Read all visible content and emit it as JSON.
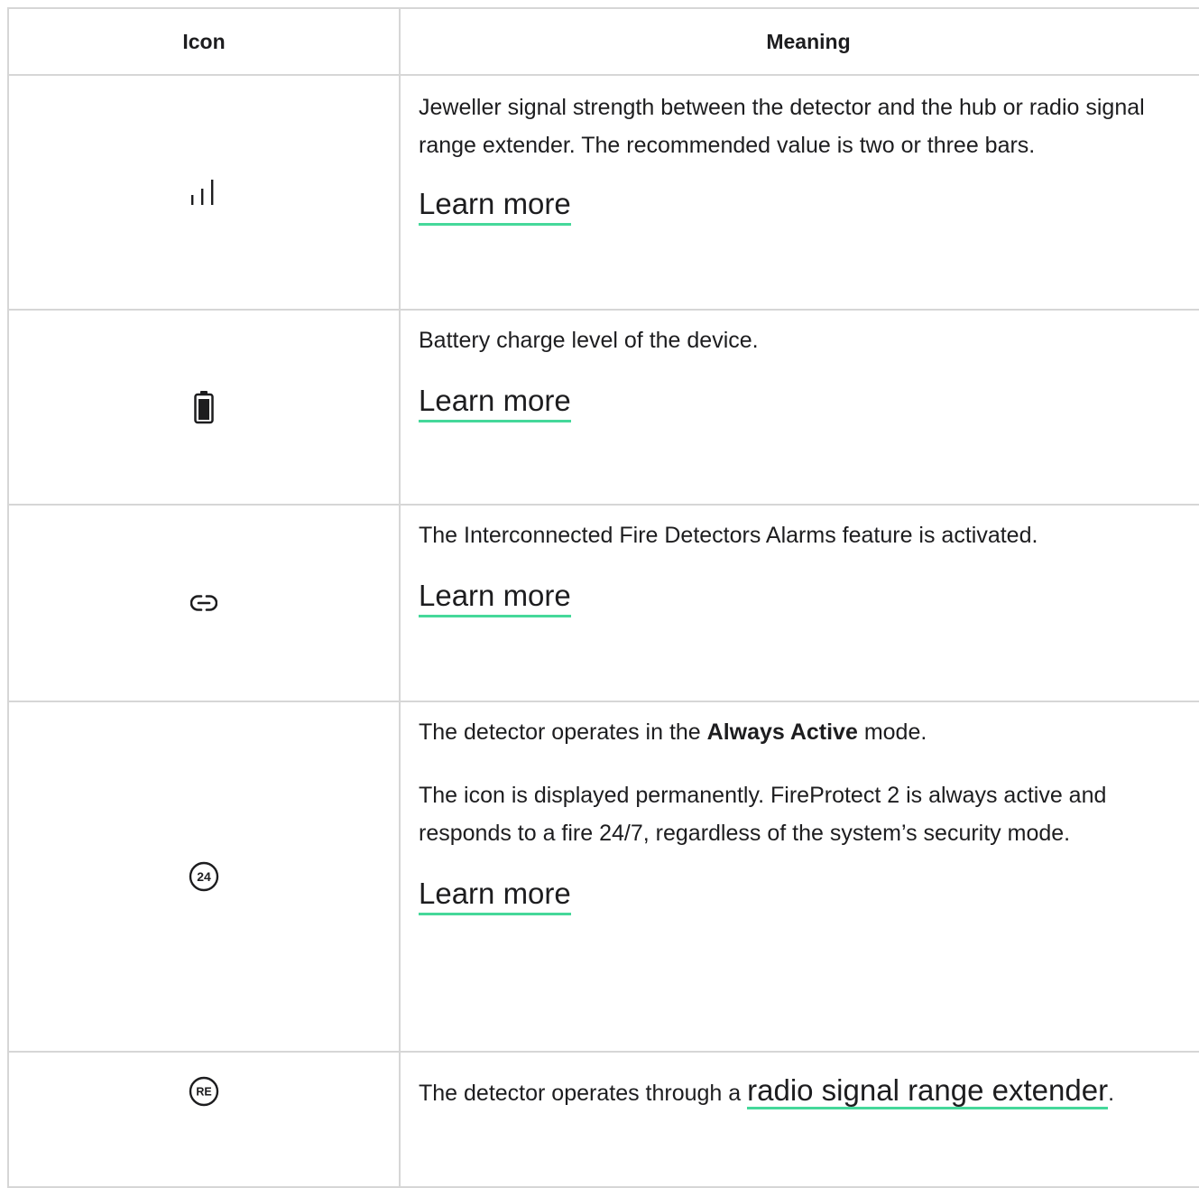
{
  "table": {
    "headers": {
      "icon": "Icon",
      "meaning": "Meaning"
    },
    "rows": [
      {
        "icon": "signal-strength-icon",
        "text": "Jeweller signal strength between the detector and the hub or radio signal range extender. The recommended value is two or three bars.",
        "link": "Learn more"
      },
      {
        "icon": "battery-icon",
        "text": "Battery charge level of the device.",
        "link": "Learn more"
      },
      {
        "icon": "link-icon",
        "text": "The Interconnected Fire Detectors Alarms feature is activated.",
        "link": "Learn more"
      },
      {
        "icon": "always-active-24-icon",
        "icon_text": "24",
        "text_before": "The detector operates in the ",
        "text_bold": "Always Active",
        "text_after": " mode.",
        "text2": "The icon is displayed permanently. FireProtect 2 is always active and responds to a fire 24/7, regardless of the system’s security mode.",
        "link": "Learn more"
      },
      {
        "icon": "range-extender-icon",
        "icon_text": "RE",
        "text_before": "The detector operates through a ",
        "link": "radio signal range extender",
        "text_after": "."
      }
    ]
  },
  "colors": {
    "border": "#d6d6d6",
    "link_underline": "#45d89a",
    "text": "#1d1d1f"
  }
}
